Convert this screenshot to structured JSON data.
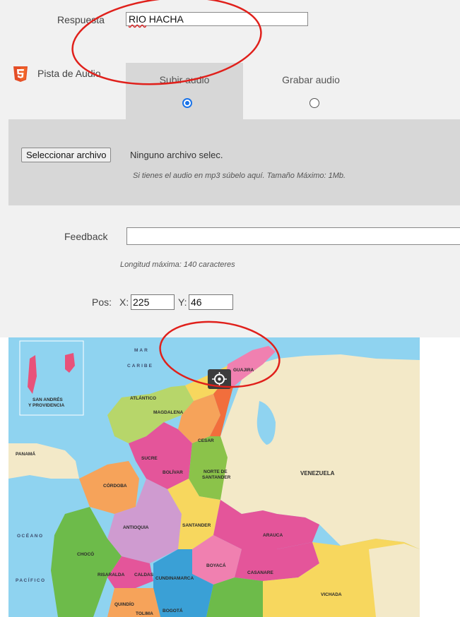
{
  "form": {
    "respuesta_label": "Respuesta",
    "respuesta_value_word1": "RIO",
    "respuesta_value_word2": " HACHA",
    "html5_badge": "HTML",
    "pista_label": "Pista de Audio",
    "tab_upload_label": "Subir audio",
    "tab_record_label": "Grabar audio",
    "upload_selected": true,
    "file_button_label": "Seleccionar archivo",
    "file_status": "Ninguno archivo selec.",
    "upload_hint": "Si tienes el audio en mp3 súbelo aquí. Tamaño Máximo: 1Mb.",
    "feedback_label": "Feedback",
    "feedback_value": "",
    "feedback_hint": "Longitud máxima: 140 caracteres",
    "pos_label": "Pos:",
    "pos_x_label": "X:",
    "pos_x_value": "225",
    "pos_y_label": "Y:",
    "pos_y_value": "46"
  },
  "map": {
    "labels": {
      "mar1": "MAR",
      "mar2": "CARIBE",
      "san_andres1": "SAN ANDRÉS",
      "san_andres2": "Y PROVIDENCIA",
      "guajira": "GUAJIRA",
      "atlantico": "ATLÁNTICO",
      "magdalena": "MAGDALENA",
      "cesar": "CESAR",
      "panama": "PANAMÁ",
      "sucre": "SUCRE",
      "bolivar": "BOLÍVAR",
      "norte1": "NORTE DE",
      "norte2": "SANTANDER",
      "venezuela": "VENEZUELA",
      "cordoba": "CÓRDOBA",
      "antioquia": "ANTIOQUIA",
      "santander": "SANTANDER",
      "arauca": "ARAUCA",
      "oceano": "OCÉANO",
      "pacifico": "PACÍFICO",
      "choco": "CHOCÓ",
      "boyaca": "BOYACÁ",
      "casanare": "CASANARE",
      "risaralda": "RISARALDA",
      "caldas": "CALDAS",
      "cundinamarca": "CUNDINAMARCA",
      "quindio": "QUINDÍO",
      "tolima": "TOLIMA",
      "bogota": "BOGOTÁ",
      "vichada": "VICHADA"
    },
    "colors": {
      "sea": "#8fd3f0",
      "neighbor": "#f3e9c8",
      "annotation": "#e0201b"
    }
  },
  "accent": "#1a73e8",
  "html5_color": "#e44d26"
}
